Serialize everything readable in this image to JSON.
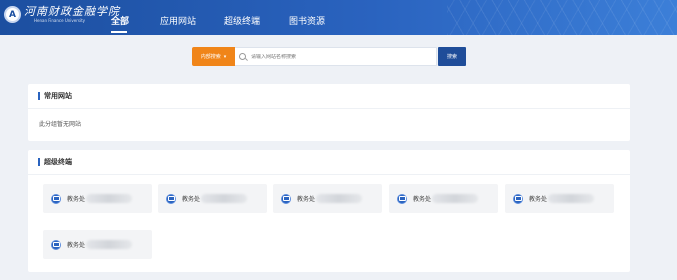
{
  "header": {
    "logo_text": "河南财政金融学院",
    "logo_subtitle": "Henan Finance University",
    "nav": [
      {
        "label": "全部",
        "active": true
      },
      {
        "label": "应用网站",
        "active": false
      },
      {
        "label": "超级终端",
        "active": false
      },
      {
        "label": "图书资源",
        "active": false
      }
    ]
  },
  "search": {
    "scope_label": "内部搜索",
    "placeholder": "请输入网站名称搜索",
    "button_label": "搜索"
  },
  "common_sites": {
    "title": "常用网站",
    "empty_text": "此分组暂无网站"
  },
  "super_terminal": {
    "title": "超级终端",
    "items": [
      {
        "label": "教务处"
      },
      {
        "label": "教务处"
      },
      {
        "label": "教务处"
      },
      {
        "label": "教务处"
      },
      {
        "label": "教务处"
      },
      {
        "label": "教务处"
      }
    ]
  },
  "colors": {
    "header_blue": "#2a63bf",
    "scope_orange": "#f08519",
    "search_button": "#1f4d99",
    "page_bg": "#eef1f6"
  }
}
